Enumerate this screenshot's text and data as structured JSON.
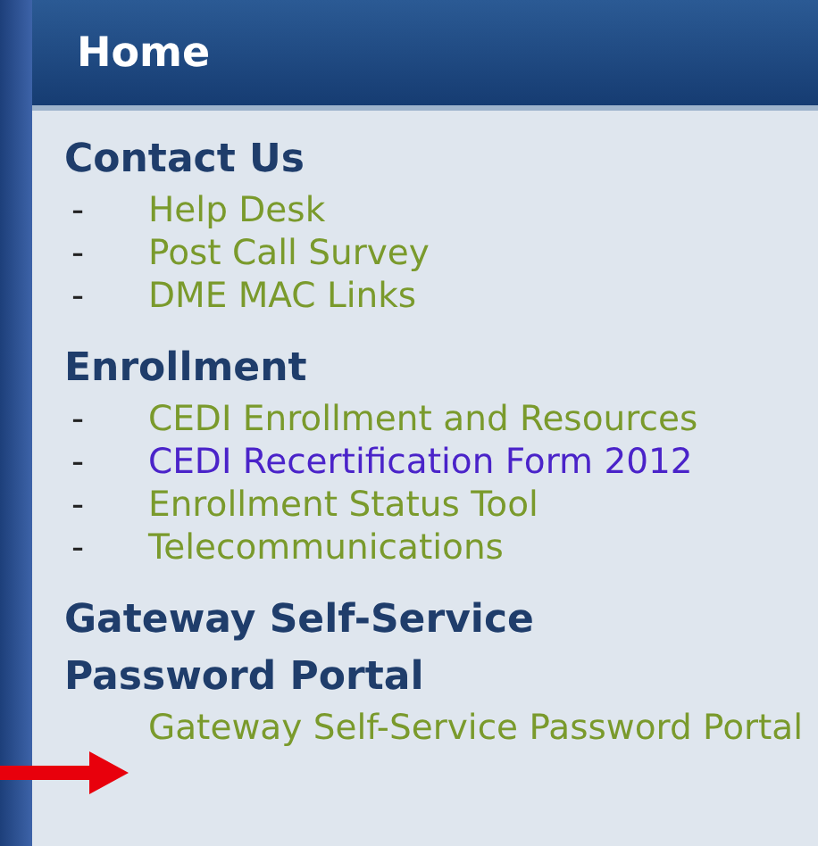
{
  "header": {
    "title": "Home"
  },
  "sections": [
    {
      "title": "Contact Us",
      "links": [
        {
          "marker": "-",
          "text": "Help Desk",
          "visited": false
        },
        {
          "marker": "-",
          "text": "Post Call Survey",
          "visited": false
        },
        {
          "marker": "-",
          "text": "DME MAC Links",
          "visited": false
        }
      ]
    },
    {
      "title": "Enrollment",
      "links": [
        {
          "marker": "-",
          "text": "CEDI Enrollment and Resources",
          "visited": false
        },
        {
          "marker": "-",
          "text": "CEDI Recertification Form 2012",
          "visited": true
        },
        {
          "marker": "-",
          "text": "Enrollment Status Tool",
          "visited": false
        },
        {
          "marker": "-",
          "text": "Telecommunications",
          "visited": false
        }
      ]
    },
    {
      "title": "Gateway Self-Service Password Portal",
      "links": [
        {
          "text": "Gateway Self-Service Password Portal",
          "visited": false
        }
      ]
    }
  ]
}
